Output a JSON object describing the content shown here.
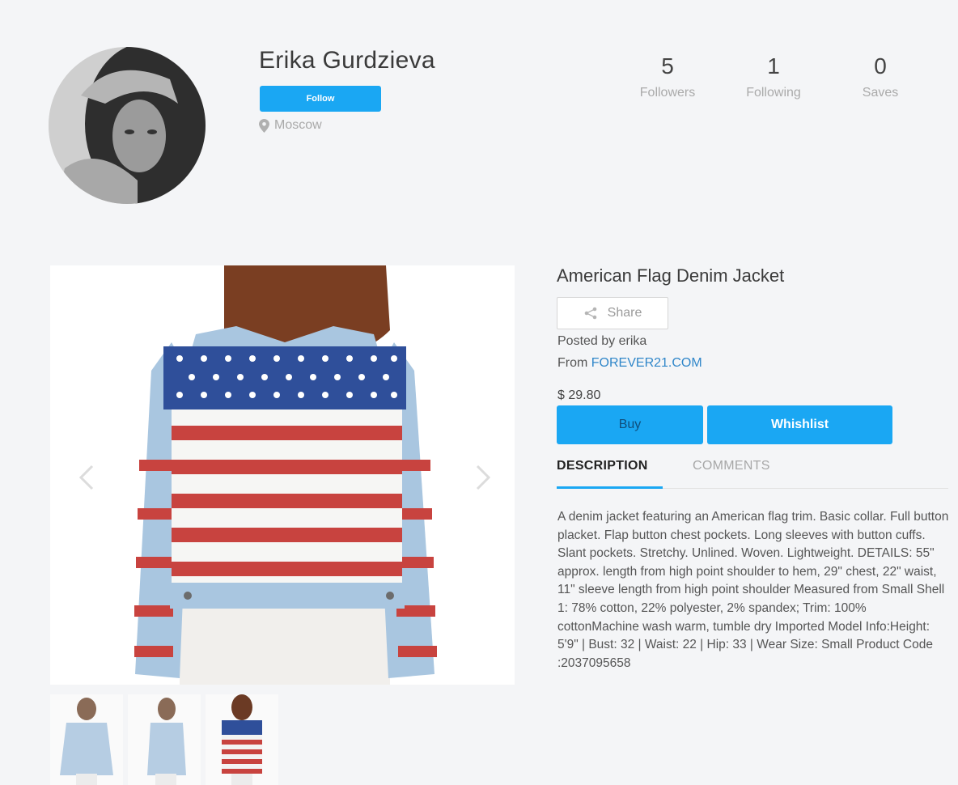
{
  "profile": {
    "name": "Erika Gurdzieva",
    "follow_label": "Follow",
    "location": "Moscow",
    "stats": [
      {
        "value": "5",
        "label": "Followers"
      },
      {
        "value": "1",
        "label": "Following"
      },
      {
        "value": "0",
        "label": "Saves"
      }
    ]
  },
  "product": {
    "title": "American Flag Denim Jacket",
    "share_label": "Share",
    "posted_by": "Posted by erika",
    "from_prefix": "From",
    "source": "FOREVER21.COM",
    "price": "$ 29.80",
    "buy_label": "Buy",
    "wishlist_label": "Whishlist",
    "tabs": [
      {
        "label": "DESCRIPTION",
        "active": true
      },
      {
        "label": "COMMENTS",
        "active": false
      }
    ],
    "description": "A denim jacket featuring an American flag trim. Basic collar. Full button placket. Flap button chest pockets. Long sleeves with button cuffs. Slant pockets. Stretchy. Unlined. Woven. Lightweight. DETAILS: 55\" approx. length from high point shoulder to hem, 29\" chest, 22\" waist, 11\" sleeve length from high point shoulder Measured from Small Shell 1: 78% cotton, 22% polyester, 2% spandex; Trim: 100% cottonMachine wash warm, tumble dry Imported Model Info:Height: 5'9\" | Bust: 32 | Waist: 22 | Hip: 33 | Wear Size: Small Product Code :2037095658"
  },
  "colors": {
    "accent": "#1aa7f3",
    "link": "#2f86c9",
    "muted": "#aaaaaa",
    "background": "#f4f5f7"
  },
  "icons": {
    "location": "map-pin-icon",
    "share": "share-icon",
    "prev": "chevron-left-icon",
    "next": "chevron-right-icon"
  }
}
